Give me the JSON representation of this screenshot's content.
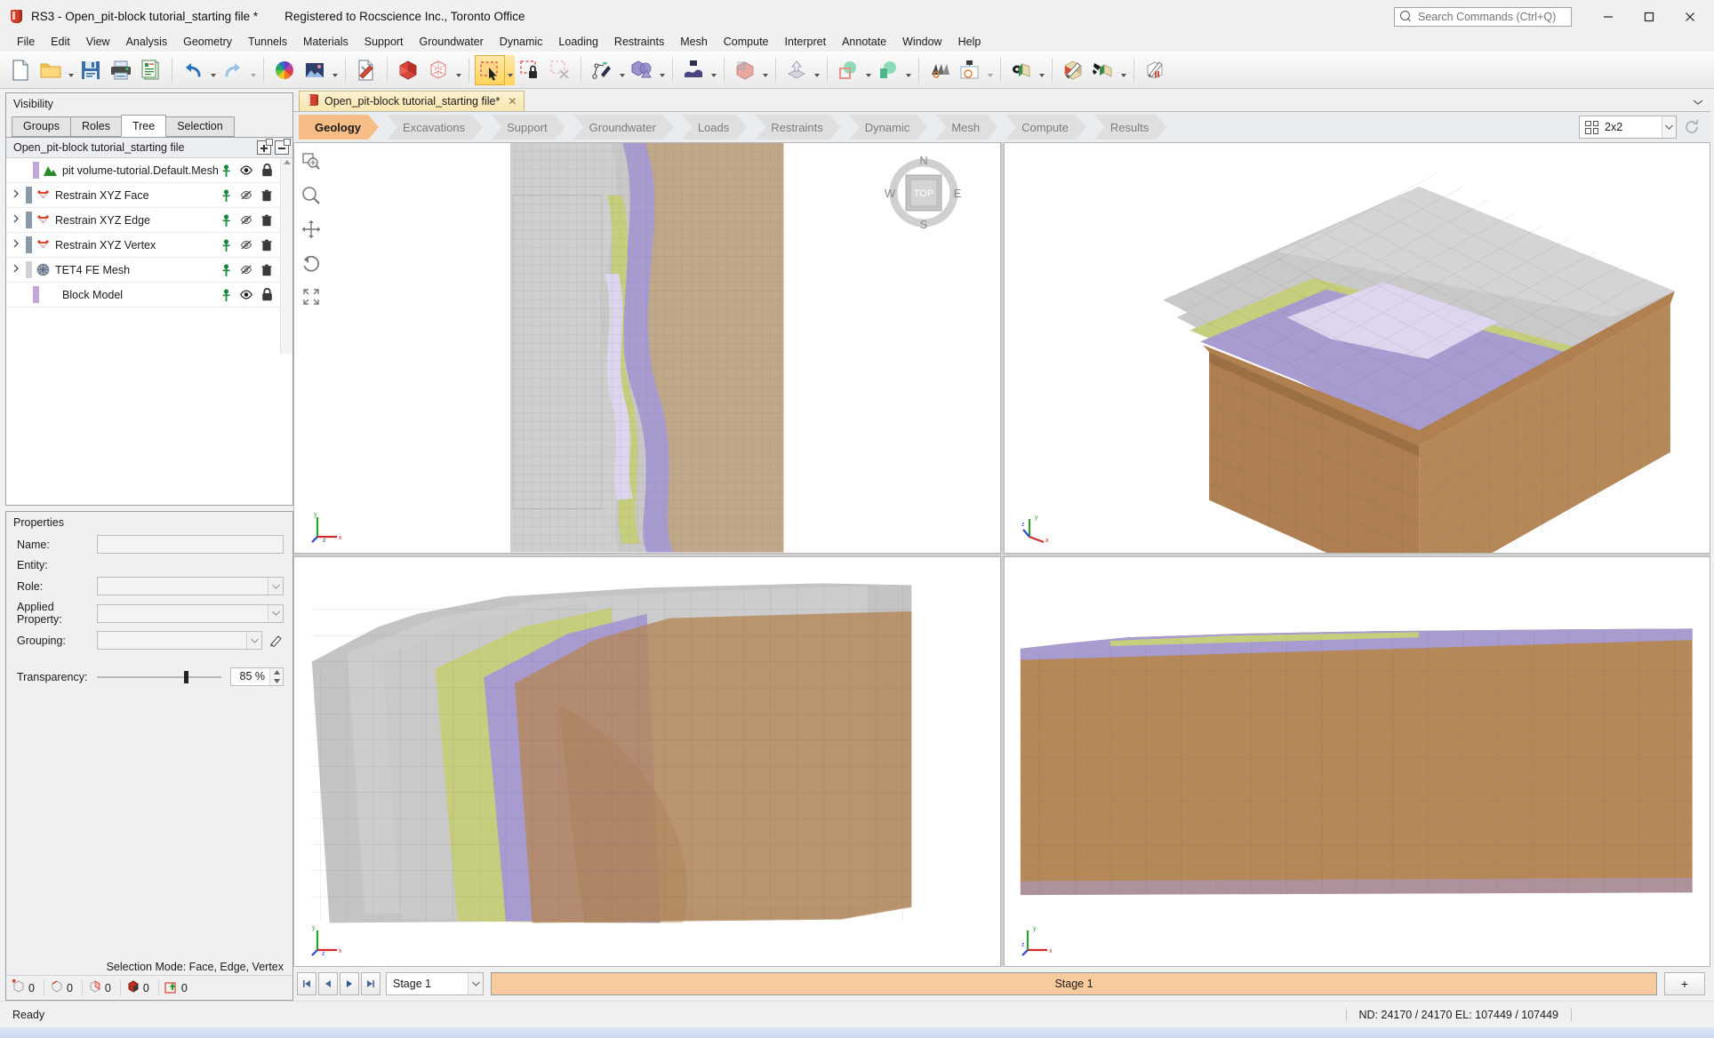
{
  "window": {
    "app_title": "RS3 - Open_pit-block tutorial_starting file *",
    "registration": "Registered to Rocscience Inc., Toronto Office",
    "logo_icon": "rs3-shield-icon",
    "minimize_icon": "—",
    "maximize_icon": "❐",
    "close_icon": "✕"
  },
  "search": {
    "placeholder": "Search Commands (Ctrl+Q)",
    "value": "",
    "icon": "search-icon"
  },
  "menubar": {
    "items": [
      {
        "label": "File"
      },
      {
        "label": "Edit"
      },
      {
        "label": "View"
      },
      {
        "label": "Analysis"
      },
      {
        "label": "Geometry"
      },
      {
        "label": "Tunnels"
      },
      {
        "label": "Materials"
      },
      {
        "label": "Support"
      },
      {
        "label": "Groundwater"
      },
      {
        "label": "Dynamic"
      },
      {
        "label": "Loading"
      },
      {
        "label": "Restraints"
      },
      {
        "label": "Mesh"
      },
      {
        "label": "Compute"
      },
      {
        "label": "Interpret"
      },
      {
        "label": "Annotate"
      },
      {
        "label": "Window"
      },
      {
        "label": "Help"
      }
    ]
  },
  "toolbar": {
    "groups": [
      {
        "buttons": [
          {
            "name": "new-file-icon",
            "dropdown": false
          },
          {
            "name": "open-folder-icon",
            "dropdown": true
          },
          {
            "name": "save-icon",
            "dropdown": false
          },
          {
            "name": "print-icon",
            "dropdown": false
          },
          {
            "name": "report-icon",
            "dropdown": false
          }
        ]
      },
      {
        "buttons": [
          {
            "name": "undo-icon",
            "dropdown": true
          },
          {
            "name": "redo-icon",
            "dropdown": true
          }
        ]
      },
      {
        "buttons": [
          {
            "name": "color-wheel-icon",
            "dropdown": false
          },
          {
            "name": "image-icon",
            "dropdown": true
          }
        ]
      },
      {
        "buttons": [
          {
            "name": "document-tools-icon",
            "dropdown": false
          }
        ]
      },
      {
        "buttons": [
          {
            "name": "solid-volume-icon",
            "dropdown": false
          },
          {
            "name": "mesh-box-icon",
            "dropdown": true
          }
        ]
      },
      {
        "buttons": [
          {
            "name": "select-entity-icon",
            "dropdown": true,
            "active": true
          },
          {
            "name": "lock-selection-icon",
            "dropdown": false
          },
          {
            "name": "clear-selection-icon",
            "dropdown": false
          }
        ]
      },
      {
        "buttons": [
          {
            "name": "geometry-pen-icon",
            "dropdown": true
          },
          {
            "name": "boolean-union-icon",
            "dropdown": true
          }
        ]
      },
      {
        "buttons": [
          {
            "name": "import-surface-icon",
            "dropdown": true
          }
        ]
      },
      {
        "buttons": [
          {
            "name": "mesh-volume-icon",
            "dropdown": true
          }
        ]
      },
      {
        "buttons": [
          {
            "name": "extrude-icon",
            "dropdown": true
          }
        ]
      },
      {
        "buttons": [
          {
            "name": "subtract-shapes-icon",
            "dropdown": true
          },
          {
            "name": "intersect-shapes-icon",
            "dropdown": true
          }
        ]
      },
      {
        "buttons": [
          {
            "name": "stage-layers-icon",
            "dropdown": false
          },
          {
            "name": "export-image-icon",
            "dropdown": false
          }
        ]
      },
      {
        "buttons": [
          {
            "name": "show-materials-icon",
            "dropdown": true
          }
        ]
      },
      {
        "buttons": [
          {
            "name": "assign-material-icon",
            "dropdown": false
          },
          {
            "name": "paint-material-icon",
            "dropdown": true
          }
        ]
      },
      {
        "buttons": [
          {
            "name": "edit-properties-icon",
            "dropdown": false
          }
        ]
      }
    ]
  },
  "visibility_panel": {
    "title": "Visibility",
    "tabs": [
      {
        "label": "Groups",
        "selected": false
      },
      {
        "label": "Roles",
        "selected": false
      },
      {
        "label": "Tree",
        "selected": true
      },
      {
        "label": "Selection",
        "selected": false
      }
    ],
    "tree_header": {
      "label": "Open_pit-block tutorial_starting file",
      "expand_all_icon": "expand-all-icon",
      "collapse_all_icon": "collapse-all-icon"
    },
    "tree_items": [
      {
        "label": "pit volume-tutorial.Default.Mesh",
        "expandable": false,
        "swatch": "#c3a7d8",
        "icon": "terrain-mesh-icon",
        "indent": 1,
        "actions": [
          "pin-icon",
          "eye-visible-icon",
          "lock-icon"
        ]
      },
      {
        "label": "Restrain XYZ Face",
        "expandable": true,
        "swatch": "#8a99a8",
        "icon": "restraint-icon",
        "indent": 0,
        "actions": [
          "pin-icon",
          "eye-hidden-icon",
          "trash-icon"
        ]
      },
      {
        "label": "Restrain XYZ Edge",
        "expandable": true,
        "swatch": "#8a99a8",
        "icon": "restraint-icon",
        "indent": 0,
        "actions": [
          "pin-icon",
          "eye-hidden-icon",
          "trash-icon"
        ]
      },
      {
        "label": "Restrain XYZ Vertex",
        "expandable": true,
        "swatch": "#8a99a8",
        "icon": "restraint-icon",
        "indent": 0,
        "actions": [
          "pin-icon",
          "eye-hidden-icon",
          "trash-icon"
        ]
      },
      {
        "label": "TET4 FE Mesh",
        "expandable": true,
        "swatch": "#d2d2d2",
        "icon": "fe-mesh-icon",
        "indent": 0,
        "actions": [
          "pin-icon",
          "eye-hidden-icon",
          "trash-icon"
        ]
      },
      {
        "label": "Block Model",
        "expandable": false,
        "swatch": "#c3a7d8",
        "icon": "",
        "indent": 1,
        "actions": [
          "pin-icon",
          "eye-visible-icon",
          "lock-icon"
        ]
      }
    ]
  },
  "properties_panel": {
    "title": "Properties",
    "fields": [
      {
        "label": "Name:",
        "type": "text",
        "value": ""
      },
      {
        "label": "Entity:",
        "type": "static",
        "value": ""
      },
      {
        "label": "Role:",
        "type": "combo",
        "value": ""
      },
      {
        "label": "Applied Property:",
        "type": "combo",
        "value": ""
      },
      {
        "label": "Grouping:",
        "type": "combo",
        "value": ""
      }
    ],
    "edit_icon": "pencil-icon",
    "transparency": {
      "label": "Transparency:",
      "value": "85 %",
      "percent": 85
    }
  },
  "selection_footer": {
    "mode_label": "Selection Mode: Face, Edge, Vertex",
    "counters": [
      {
        "icon": "vertex-count-icon",
        "value": "0"
      },
      {
        "icon": "edge-count-icon",
        "value": "0"
      },
      {
        "icon": "face-count-icon",
        "value": "0"
      },
      {
        "icon": "volume-count-icon",
        "value": "0"
      },
      {
        "icon": "group-count-icon",
        "value": "0"
      }
    ]
  },
  "document_tabs": [
    {
      "label": "Open_pit-block tutorial_starting file*",
      "icon": "rs3-doc-icon",
      "close_icon": "✕",
      "selected": true
    }
  ],
  "workflow_tabs": [
    {
      "label": "Geology",
      "selected": true
    },
    {
      "label": "Excavations",
      "selected": false
    },
    {
      "label": "Support",
      "selected": false
    },
    {
      "label": "Groundwater",
      "selected": false
    },
    {
      "label": "Loads",
      "selected": false
    },
    {
      "label": "Restraints",
      "selected": false
    },
    {
      "label": "Dynamic",
      "selected": false
    },
    {
      "label": "Mesh",
      "selected": false
    },
    {
      "label": "Compute",
      "selected": false
    },
    {
      "label": "Results",
      "selected": false
    }
  ],
  "layout_selector": {
    "icon": "grid-2x2-icon",
    "label": "2x2",
    "dropdown_icon": "chevron-down-icon",
    "refresh_icon": "refresh-icon"
  },
  "viewport_tools": [
    {
      "name": "zoom-window-icon"
    },
    {
      "name": "zoom-icon"
    },
    {
      "name": "pan-icon"
    },
    {
      "name": "rotate-icon"
    },
    {
      "name": "zoom-extents-icon"
    }
  ],
  "viewports": [
    {
      "name": "top-view",
      "compass": {
        "north": "N",
        "south": "S",
        "east": "E",
        "west": "W",
        "face": "TOP"
      },
      "axes": "xyz-axes-icon"
    },
    {
      "name": "iso-view",
      "axes": "xyz-axes-icon"
    },
    {
      "name": "front-view",
      "axes": "xyz-axes-icon"
    },
    {
      "name": "side-view",
      "axes": "xyz-axes-icon"
    }
  ],
  "stage_bar": {
    "first_icon": "◀│",
    "prev_icon": "◀",
    "next_icon": "▶",
    "last_icon": "│▶",
    "stage_value": "Stage 1",
    "dropdown_icon": "chevron-down-icon",
    "track_label": "Stage 1",
    "add_stage_label": "+"
  },
  "status_bar": {
    "ready": "Ready",
    "node_element_info": "ND: 24170 / 24170  EL: 107449 / 107449"
  },
  "colors": {
    "accent_orange": "#f6be86",
    "tab_yellow": "#f6e5ac",
    "stage_track": "#f7cb9d",
    "geology_olive": "#c4cf7b",
    "geology_purple": "#a096c8",
    "geology_lavender": "#d6cde8",
    "geology_brown": "#b5885a",
    "geology_grey": "#c9c9c9"
  }
}
